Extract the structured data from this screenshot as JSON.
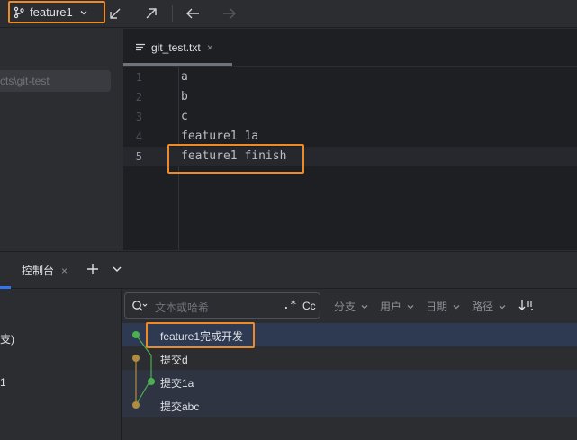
{
  "toolbar": {
    "branch": "feature1",
    "icons": [
      "branch-icon",
      "chevron-down-icon",
      "update-project-icon",
      "push-icon",
      "back-icon",
      "forward-icon"
    ]
  },
  "project": {
    "path_fragment": "cts\\git-test"
  },
  "editor": {
    "tab_name": "git_test.txt",
    "tab_close": "×",
    "lines": [
      {
        "num": "1",
        "text": "a"
      },
      {
        "num": "2",
        "text": "b"
      },
      {
        "num": "3",
        "text": "c"
      },
      {
        "num": "4",
        "text": "feature1 1a"
      },
      {
        "num": "5",
        "text": "feature1 finish"
      }
    ]
  },
  "bottom": {
    "console_tab": "控制台",
    "console_close": "×",
    "left_fragments": [
      "支)",
      "1"
    ],
    "search_placeholder": "文本或哈希",
    "regex_label": ".*",
    "case_label": "Cc",
    "filters": [
      "分支",
      "用户",
      "日期",
      "路径"
    ],
    "commits": [
      {
        "message": "feature1完成开发",
        "color": "#4caf50"
      },
      {
        "message": "提交d",
        "color": "#b08d3c"
      },
      {
        "message": "提交1a",
        "color": "#4caf50"
      },
      {
        "message": "提交abc",
        "color": "#b08d3c"
      }
    ]
  },
  "colors": {
    "highlight_box": "#f08a24",
    "feature_branch": "#4caf50",
    "main_branch": "#b08d3c",
    "selection": "#2e3a52"
  }
}
